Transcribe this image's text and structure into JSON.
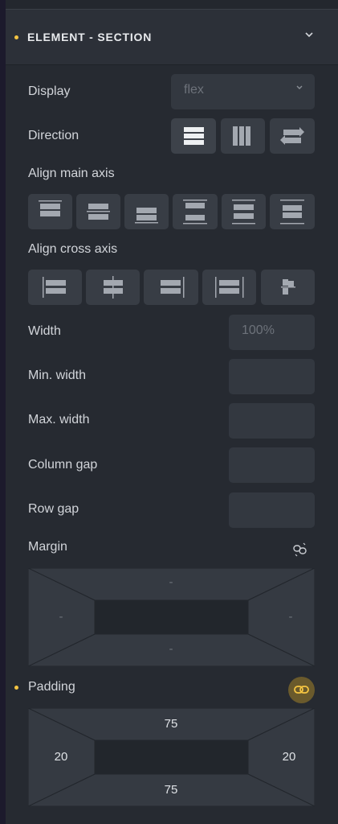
{
  "section": {
    "title": "ELEMENT - SECTION"
  },
  "display": {
    "label": "Display",
    "value": "flex"
  },
  "direction": {
    "label": "Direction",
    "options": [
      "row",
      "column",
      "row-reverse"
    ]
  },
  "align_main": {
    "label": "Align main axis"
  },
  "align_cross": {
    "label": "Align cross axis"
  },
  "width": {
    "label": "Width",
    "placeholder": "100%"
  },
  "min_width": {
    "label": "Min. width"
  },
  "max_width": {
    "label": "Max. width"
  },
  "column_gap": {
    "label": "Column gap"
  },
  "row_gap": {
    "label": "Row gap"
  },
  "margin": {
    "label": "Margin",
    "top": "-",
    "right": "-",
    "bottom": "-",
    "left": "-",
    "linked": false
  },
  "padding": {
    "label": "Padding",
    "top": "75",
    "right": "20",
    "bottom": "75",
    "left": "20",
    "linked": true
  },
  "colors": {
    "accent": "#f5c542",
    "panel": "#262a31",
    "control": "#333840"
  }
}
